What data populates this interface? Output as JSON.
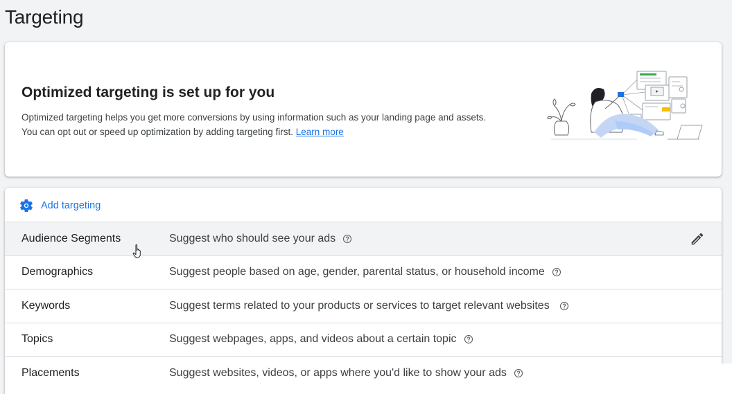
{
  "page": {
    "title": "Targeting"
  },
  "banner": {
    "title": "Optimized targeting is set up for you",
    "desc_line1": "Optimized targeting helps you get more conversions by using information such as your landing page and assets.",
    "desc_line2": "You can opt out or speed up optimization by adding targeting first.",
    "learn_more": "Learn more"
  },
  "targeting": {
    "add_label": "Add targeting",
    "items": [
      {
        "name": "Audience Segments",
        "description": "Suggest who should see your ads",
        "hovered": true
      },
      {
        "name": "Demographics",
        "description": "Suggest people based on age, gender, parental status, or household income"
      },
      {
        "name": "Keywords",
        "description": "Suggest terms related to your products or services to target relevant websites"
      },
      {
        "name": "Topics",
        "description": "Suggest webpages, apps, and videos about a certain topic"
      },
      {
        "name": "Placements",
        "description": "Suggest websites, videos, or apps where you'd like to show your ads"
      }
    ]
  },
  "icons": {
    "gear": "gear-icon",
    "help": "help-circle-icon",
    "edit": "pencil-icon",
    "cursor": "hand-pointer-cursor"
  },
  "colors": {
    "accent": "#1a73e8",
    "background": "#f1f3f4",
    "divider": "#dadce0"
  }
}
